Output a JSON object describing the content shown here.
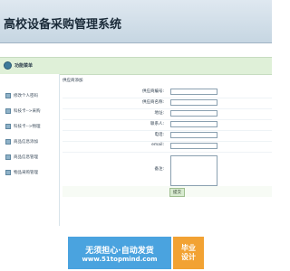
{
  "header": {
    "nav_links": [
      "",
      "",
      ""
    ],
    "title": "高校设备采购管理系统"
  },
  "sidebar": {
    "heading": "功能菜单",
    "items": [
      {
        "label": "修改个人密码"
      },
      {
        "label": "科技卡-->采购"
      },
      {
        "label": "科技卡-->物理"
      },
      {
        "label": "商品信息添加"
      },
      {
        "label": "商品信息管理"
      },
      {
        "label": "物品采购管理"
      }
    ]
  },
  "main": {
    "breadcrumb": "供应商添加",
    "fields": [
      {
        "label": "供应商编号:",
        "value": ""
      },
      {
        "label": "供应商名称:",
        "value": ""
      },
      {
        "label": "地址:",
        "value": ""
      },
      {
        "label": "联系人:",
        "value": ""
      },
      {
        "label": "电话:",
        "value": ""
      },
      {
        "label": "email:",
        "value": ""
      },
      {
        "label": "备注:",
        "value": ""
      }
    ],
    "submit_label": "提交"
  },
  "banner": {
    "line1": "无须担心·自动发货",
    "line2": "www.51topmind.com",
    "side_line1": "毕业",
    "side_line2": "设计"
  },
  "colors": {
    "header_bg": "#c6d6e2",
    "accent_green": "#dff0d8",
    "banner_blue": "#4aa3df",
    "banner_orange": "#f2a233"
  }
}
